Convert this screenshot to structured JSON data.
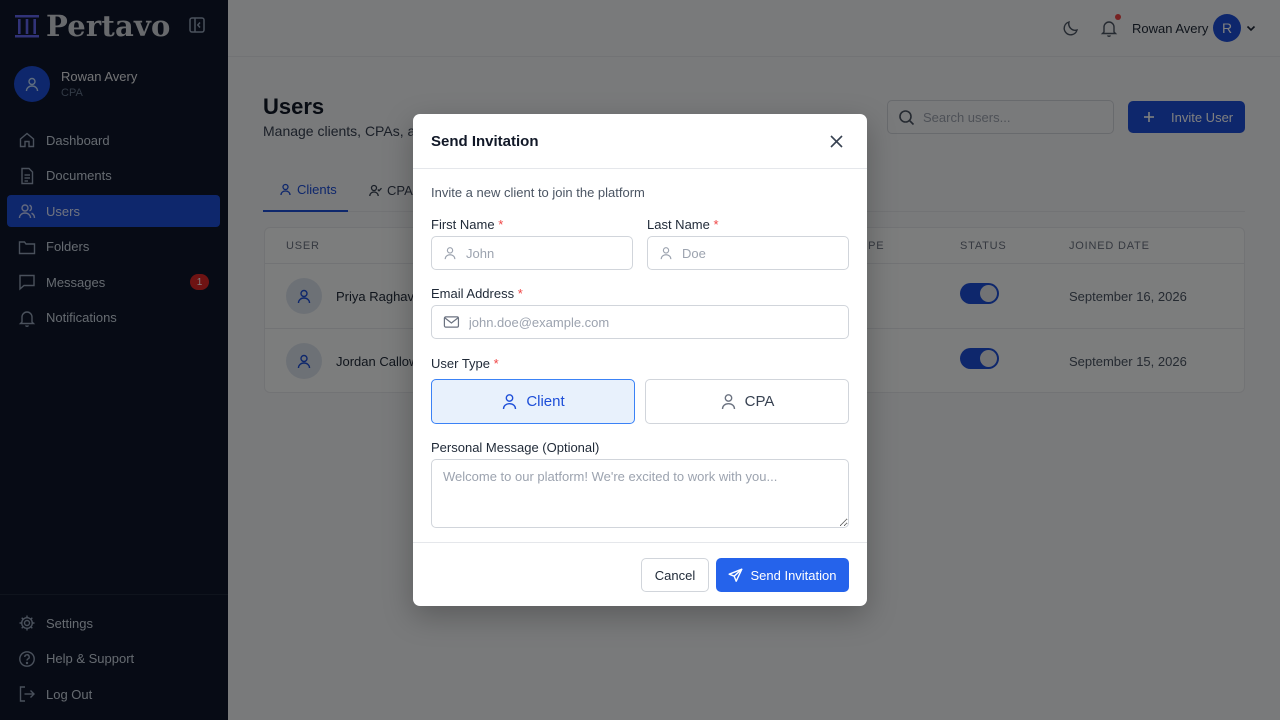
{
  "app": {
    "logo": "Pertavo"
  },
  "sidebar": {
    "profile": {
      "name": "Rowan Avery",
      "role": "CPA"
    },
    "nav": [
      {
        "label": "Dashboard",
        "icon": "home-icon"
      },
      {
        "label": "Documents",
        "icon": "document-icon"
      },
      {
        "label": "Users",
        "icon": "users-icon",
        "active": true
      },
      {
        "label": "Folders",
        "icon": "folder-icon"
      },
      {
        "label": "Messages",
        "icon": "message-icon",
        "badge": "1"
      },
      {
        "label": "Notifications",
        "icon": "bell-icon"
      }
    ],
    "bottom": [
      {
        "label": "Settings",
        "icon": "gear-icon"
      },
      {
        "label": "Help & Support",
        "icon": "help-icon"
      },
      {
        "label": "Log Out",
        "icon": "logout-icon"
      }
    ]
  },
  "topbar": {
    "user_name": "Rowan Avery",
    "avatar_initial": "R"
  },
  "page": {
    "title": "Users",
    "subtitle": "Manage clients, CPAs, a",
    "search_placeholder": "Search users...",
    "invite_label": "Invite User",
    "tabs": [
      {
        "label": "Clients",
        "active": true
      },
      {
        "label": "CPAs"
      }
    ],
    "table": {
      "headers": {
        "user": "USER",
        "type": "YPE",
        "status": "STATUS",
        "joined": "JOINED DATE"
      },
      "rows": [
        {
          "name": "Priya Raghava",
          "status_on": true,
          "joined": "September 16, 2026"
        },
        {
          "name": "Jordan Callow",
          "status_on": true,
          "joined": "September 15, 2026"
        }
      ]
    }
  },
  "modal": {
    "title": "Send Invitation",
    "description": "Invite a new client to join the platform",
    "first_name": {
      "label": "First Name",
      "required": "*",
      "placeholder": "John",
      "value": ""
    },
    "last_name": {
      "label": "Last Name",
      "required": "*",
      "placeholder": "Doe",
      "value": ""
    },
    "email": {
      "label": "Email Address",
      "required": "*",
      "placeholder": "john.doe@example.com",
      "value": ""
    },
    "user_type": {
      "label": "User Type",
      "required": "*",
      "options": [
        "Client",
        "CPA"
      ],
      "selected": "Client"
    },
    "message": {
      "label": "Personal Message (Optional)",
      "placeholder": "Welcome to our platform! We're excited to work with you...",
      "value": ""
    },
    "cancel_label": "Cancel",
    "send_label": "Send Invitation"
  },
  "colors": {
    "accent": "#1d4ed8",
    "sidebar_bg": "#0f172a",
    "badge": "#dc2626",
    "required": "#ef4444"
  }
}
